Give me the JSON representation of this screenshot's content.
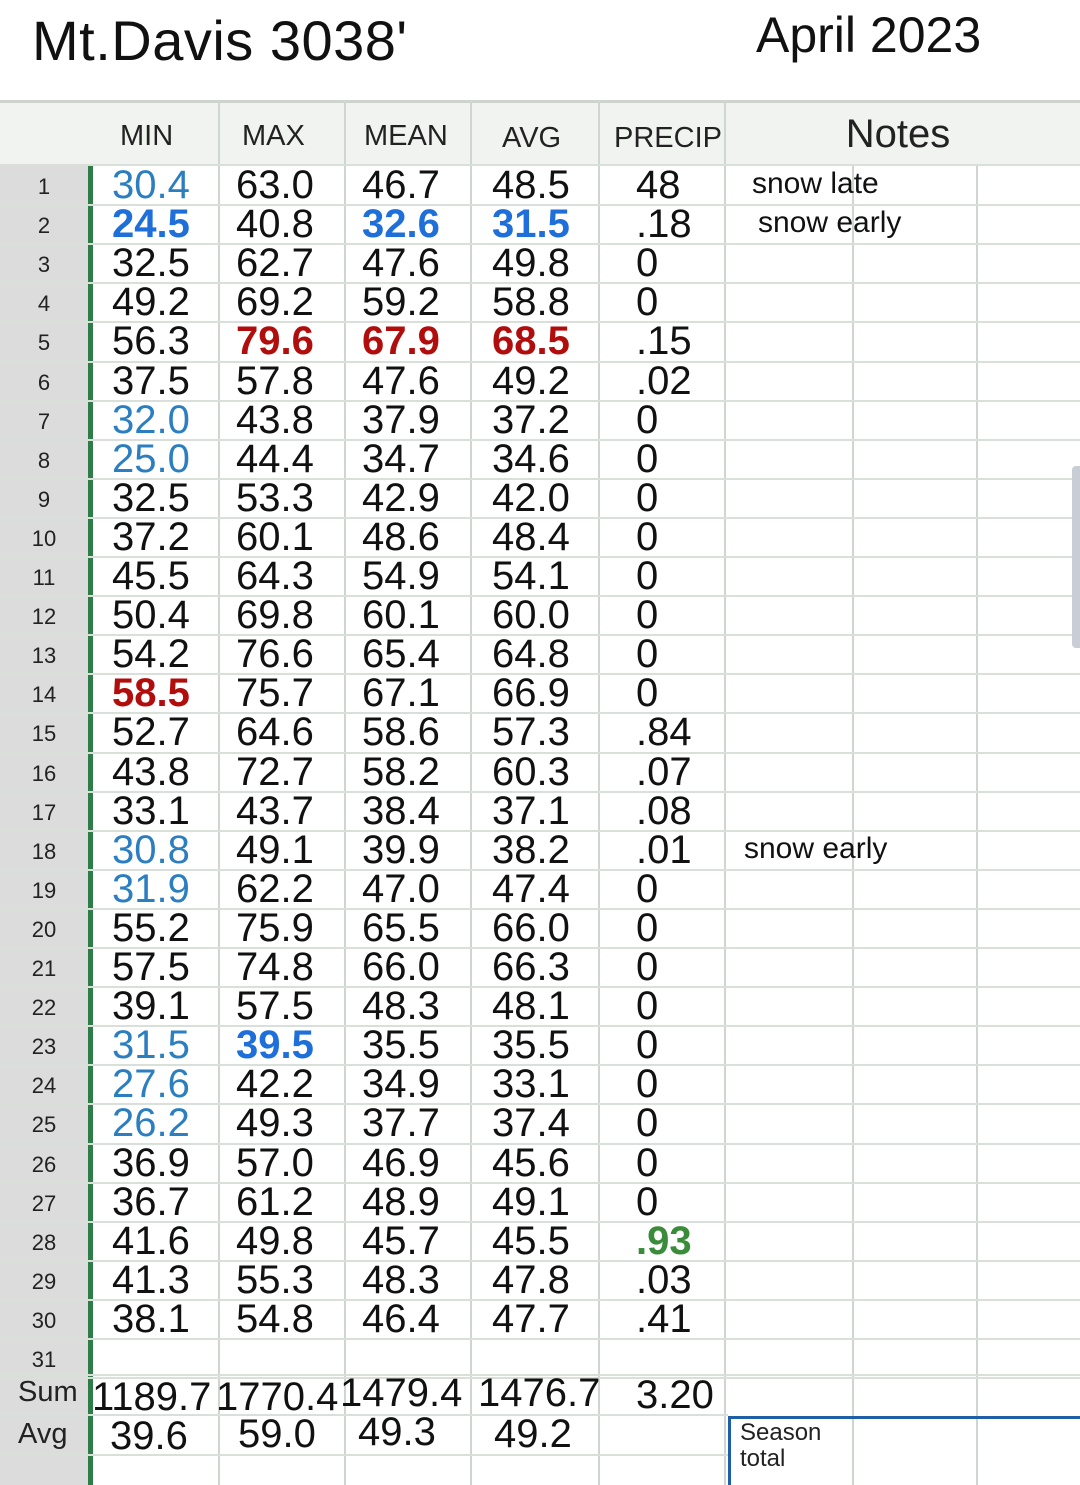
{
  "header": {
    "title": "Mt.Davis  3038'",
    "month": "April 2023"
  },
  "columns": [
    "MIN",
    "MAX",
    "MEAN",
    "AVG",
    "PRECIP"
  ],
  "notes_header": "Notes",
  "rows": [
    {
      "day": "1",
      "min": "30.4",
      "max": "63.0",
      "mean": "46.7",
      "avg": "48.5",
      "precip": "48",
      "note": "snow late",
      "hl": {
        "min": "blue"
      }
    },
    {
      "day": "2",
      "min": "24.5",
      "max": "40.8",
      "mean": "32.6",
      "avg": "31.5",
      "precip": ".18",
      "note": "snow early",
      "hl": {
        "min": "bblue",
        "mean": "bblue",
        "avg": "bblue"
      }
    },
    {
      "day": "3",
      "min": "32.5",
      "max": "62.7",
      "mean": "47.6",
      "avg": "49.8",
      "precip": "0",
      "note": "",
      "hl": {}
    },
    {
      "day": "4",
      "min": "49.2",
      "max": "69.2",
      "mean": "59.2",
      "avg": "58.8",
      "precip": "0",
      "note": "",
      "hl": {}
    },
    {
      "day": "5",
      "min": "56.3",
      "max": "79.6",
      "mean": "67.9",
      "avg": "68.5",
      "precip": ".15",
      "note": "",
      "hl": {
        "max": "red",
        "mean": "red",
        "avg": "red"
      }
    },
    {
      "day": "6",
      "min": "37.5",
      "max": "57.8",
      "mean": "47.6",
      "avg": "49.2",
      "precip": ".02",
      "note": "",
      "hl": {}
    },
    {
      "day": "7",
      "min": "32.0",
      "max": "43.8",
      "mean": "37.9",
      "avg": "37.2",
      "precip": "0",
      "note": "",
      "hl": {
        "min": "blue"
      }
    },
    {
      "day": "8",
      "min": "25.0",
      "max": "44.4",
      "mean": "34.7",
      "avg": "34.6",
      "precip": "0",
      "note": "",
      "hl": {
        "min": "blue"
      }
    },
    {
      "day": "9",
      "min": "32.5",
      "max": "53.3",
      "mean": "42.9",
      "avg": "42.0",
      "precip": "0",
      "note": "",
      "hl": {}
    },
    {
      "day": "10",
      "min": "37.2",
      "max": "60.1",
      "mean": "48.6",
      "avg": "48.4",
      "precip": "0",
      "note": "",
      "hl": {}
    },
    {
      "day": "11",
      "min": "45.5",
      "max": "64.3",
      "mean": "54.9",
      "avg": "54.1",
      "precip": "0",
      "note": "",
      "hl": {}
    },
    {
      "day": "12",
      "min": "50.4",
      "max": "69.8",
      "mean": "60.1",
      "avg": "60.0",
      "precip": "0",
      "note": "",
      "hl": {}
    },
    {
      "day": "13",
      "min": "54.2",
      "max": "76.6",
      "mean": "65.4",
      "avg": "64.8",
      "precip": "0",
      "note": "",
      "hl": {}
    },
    {
      "day": "14",
      "min": "58.5",
      "max": "75.7",
      "mean": "67.1",
      "avg": "66.9",
      "precip": "0",
      "note": "",
      "hl": {
        "min": "red"
      }
    },
    {
      "day": "15",
      "min": "52.7",
      "max": "64.6",
      "mean": "58.6",
      "avg": "57.3",
      "precip": ".84",
      "note": "",
      "hl": {}
    },
    {
      "day": "16",
      "min": "43.8",
      "max": "72.7",
      "mean": "58.2",
      "avg": "60.3",
      "precip": ".07",
      "note": "",
      "hl": {}
    },
    {
      "day": "17",
      "min": "33.1",
      "max": "43.7",
      "mean": "38.4",
      "avg": "37.1",
      "precip": ".08",
      "note": "",
      "hl": {}
    },
    {
      "day": "18",
      "min": "30.8",
      "max": "49.1",
      "mean": "39.9",
      "avg": "38.2",
      "precip": ".01",
      "note": "snow early",
      "hl": {
        "min": "blue"
      }
    },
    {
      "day": "19",
      "min": "31.9",
      "max": "62.2",
      "mean": "47.0",
      "avg": "47.4",
      "precip": "0",
      "note": "",
      "hl": {
        "min": "blue"
      }
    },
    {
      "day": "20",
      "min": "55.2",
      "max": "75.9",
      "mean": "65.5",
      "avg": "66.0",
      "precip": "0",
      "note": "",
      "hl": {}
    },
    {
      "day": "21",
      "min": "57.5",
      "max": "74.8",
      "mean": "66.0",
      "avg": "66.3",
      "precip": "0",
      "note": "",
      "hl": {}
    },
    {
      "day": "22",
      "min": "39.1",
      "max": "57.5",
      "mean": "48.3",
      "avg": "48.1",
      "precip": "0",
      "note": "",
      "hl": {}
    },
    {
      "day": "23",
      "min": "31.5",
      "max": "39.5",
      "mean": "35.5",
      "avg": "35.5",
      "precip": "0",
      "note": "",
      "hl": {
        "min": "blue",
        "max": "bblue"
      }
    },
    {
      "day": "24",
      "min": "27.6",
      "max": "42.2",
      "mean": "34.9",
      "avg": "33.1",
      "precip": "0",
      "note": "",
      "hl": {
        "min": "blue"
      }
    },
    {
      "day": "25",
      "min": "26.2",
      "max": "49.3",
      "mean": "37.7",
      "avg": "37.4",
      "precip": "0",
      "note": "",
      "hl": {
        "min": "blue"
      }
    },
    {
      "day": "26",
      "min": "36.9",
      "max": "57.0",
      "mean": "46.9",
      "avg": "45.6",
      "precip": "0",
      "note": "",
      "hl": {}
    },
    {
      "day": "27",
      "min": "36.7",
      "max": "61.2",
      "mean": "48.9",
      "avg": "49.1",
      "precip": "0",
      "note": "",
      "hl": {}
    },
    {
      "day": "28",
      "min": "41.6",
      "max": "49.8",
      "mean": "45.7",
      "avg": "45.5",
      "precip": ".93",
      "note": "",
      "hl": {
        "precip": "green"
      }
    },
    {
      "day": "29",
      "min": "41.3",
      "max": "55.3",
      "mean": "48.3",
      "avg": "47.8",
      "precip": ".03",
      "note": "",
      "hl": {}
    },
    {
      "day": "30",
      "min": "38.1",
      "max": "54.8",
      "mean": "46.4",
      "avg": "47.7",
      "precip": ".41",
      "note": "",
      "hl": {}
    },
    {
      "day": "31",
      "min": "",
      "max": "",
      "mean": "",
      "avg": "",
      "precip": "",
      "note": "",
      "hl": {}
    }
  ],
  "sum": {
    "label": "Sum",
    "min": "1189.7",
    "max": "1770.4",
    "mean": "1479.4",
    "avg": "1476.7",
    "precip": "3.20"
  },
  "avg": {
    "label": "Avg",
    "min": "39.6",
    "max": "59.0",
    "mean": "49.3",
    "avg": "49.2"
  },
  "season_total": "Season total",
  "colors": {
    "blue": "#2b7fc0",
    "bold_blue": "#1e6fd9",
    "red": "#b10d0d",
    "green": "#3a8c3a",
    "gridline_green": "#2e7d48"
  }
}
